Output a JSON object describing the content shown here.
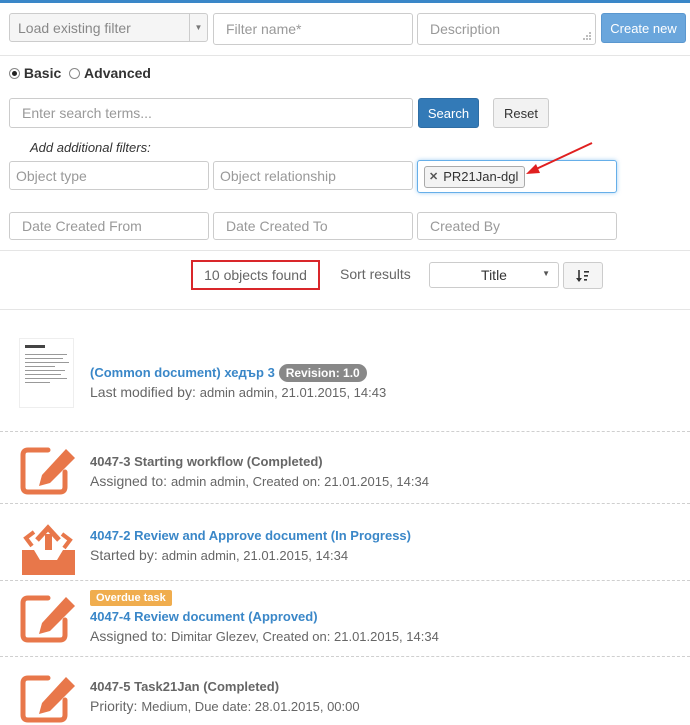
{
  "filter_bar": {
    "load_filter_placeholder": "Load existing filter",
    "filter_name_placeholder": "Filter name*",
    "description_placeholder": "Description",
    "create_new_label": "Create new"
  },
  "search_mode": {
    "basic_label": "Basic",
    "advanced_label": "Advanced",
    "selected": "Basic"
  },
  "search": {
    "placeholder": "Enter search terms...",
    "search_label": "Search",
    "reset_label": "Reset"
  },
  "additional_filters": {
    "heading": "Add additional filters:",
    "object_type_placeholder": "Object type",
    "object_relationship_placeholder": "Object relationship",
    "tag_value": "PR21Jan-dgl",
    "date_from_placeholder": "Date Created From",
    "date_to_placeholder": "Date Created To",
    "created_by_placeholder": "Created By"
  },
  "results_bar": {
    "count_text": "10 objects found",
    "sort_label": "Sort results",
    "sort_value": "Title"
  },
  "results": [
    {
      "icon": "document-thumbnail-icon",
      "title": "(Common document) хедър 3",
      "badge": "Revision: 1.0",
      "meta_prefix": "Last modified by:",
      "meta_value": "admin admin, 21.01.2015, 14:43"
    },
    {
      "icon": "edit-task-icon",
      "title": "4047-3 Starting workflow (Completed)",
      "meta_prefix": "Assigned to:",
      "meta_value": "admin admin, Created on: 21.01.2015, 14:34"
    },
    {
      "icon": "workflow-inbox-icon",
      "title": "4047-2 Review and Approve document (In Progress)",
      "meta_prefix": "Started by:",
      "meta_value": "admin admin, 21.01.2015, 14:34"
    },
    {
      "icon": "edit-task-icon",
      "overdue": "Overdue task",
      "title": "4047-4 Review document (Approved)",
      "meta_prefix": "Assigned to:",
      "meta_value": "Dimitar Glezev, Created on: 21.01.2015, 14:34"
    },
    {
      "icon": "edit-task-icon",
      "title": "4047-5 Task21Jan (Completed)",
      "meta_prefix": "Priority:",
      "meta_value": "Medium, Due date: 28.01.2015, 00:00"
    }
  ],
  "colors": {
    "link": "#3a87c8",
    "task_icon": "#e8774a",
    "highlight_box": "#d9262a",
    "annotation_arrow": "#e02020"
  }
}
